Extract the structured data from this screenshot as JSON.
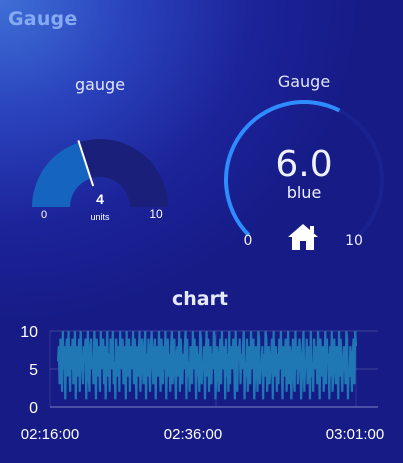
{
  "panel": {
    "title": "Gauge"
  },
  "gauge_left": {
    "label": "gauge",
    "value": 4,
    "value_text": "4",
    "units": "units",
    "min": 0,
    "max": 10,
    "min_text": "0",
    "max_text": "10",
    "colors": {
      "track": "#1a1f7a",
      "fill": "#1565c0",
      "needle": "#ffffff"
    }
  },
  "gauge_right": {
    "label": "Gauge",
    "value": 6.0,
    "value_text": "6.0",
    "subtitle": "blue",
    "min": 0,
    "max": 10,
    "min_text": "0",
    "max_text": "10",
    "icon": "home-icon",
    "colors": {
      "track": "#1a2290",
      "fill": "#2e8cff"
    }
  },
  "chart": {
    "title": "chart"
  },
  "chart_data": {
    "type": "line",
    "title": "chart",
    "xlabel": "",
    "ylabel": "",
    "ylim": [
      0,
      10
    ],
    "yticks": [
      "0",
      "5",
      "10"
    ],
    "xticks": [
      "02:16:00",
      "02:36:00",
      "03:01:00"
    ],
    "line_color": "#1f77b4",
    "grid": true,
    "series": [
      {
        "values": [
          6,
          8,
          3,
          9,
          7,
          2,
          10,
          5,
          8,
          1,
          7,
          9,
          4,
          10,
          6,
          2,
          8,
          5,
          9,
          3,
          7,
          10,
          1,
          6,
          8,
          4,
          9,
          2,
          10,
          7,
          5,
          3,
          8,
          6,
          9,
          1,
          7,
          10,
          4,
          2,
          8,
          9,
          5,
          6,
          3,
          10,
          7,
          1,
          9,
          4,
          8,
          6,
          2,
          10,
          5,
          7,
          9,
          3,
          8,
          1,
          6,
          10,
          4,
          7,
          2,
          9,
          5,
          8,
          10,
          3,
          6,
          1,
          9,
          7,
          4,
          8,
          2,
          10,
          6,
          5,
          9,
          3,
          7,
          8,
          1,
          10,
          4,
          6,
          9,
          2,
          8,
          5,
          7,
          10,
          3,
          9,
          6,
          1,
          8,
          4,
          7,
          10,
          2,
          5,
          9,
          6,
          3,
          8,
          10,
          1,
          7,
          4,
          9,
          5,
          2,
          8,
          10,
          6,
          3,
          7,
          9,
          1,
          8,
          5,
          4,
          10,
          6,
          2,
          9,
          7,
          3,
          8,
          5,
          10,
          1,
          6,
          9,
          4,
          7,
          2,
          8,
          10,
          3,
          6,
          9,
          5,
          1,
          7,
          8,
          4,
          10,
          2,
          9,
          6,
          3,
          7,
          5,
          8,
          10,
          1,
          9,
          4,
          6,
          2,
          8,
          7,
          3,
          10,
          5,
          9,
          6,
          1,
          8,
          4,
          7,
          2,
          10,
          9,
          3,
          6,
          5,
          8,
          1,
          7,
          10,
          4,
          9,
          2,
          6,
          8,
          3,
          7,
          5,
          10,
          9,
          1,
          4,
          8,
          6,
          2,
          7,
          9,
          3,
          10,
          5,
          6,
          8,
          1,
          9,
          4,
          7,
          2,
          10,
          3,
          8,
          6,
          5,
          9,
          7,
          1,
          10,
          4,
          2,
          8,
          6,
          9,
          3,
          7,
          5,
          8,
          10,
          1,
          6,
          4,
          9,
          2,
          7,
          8,
          3,
          10,
          5,
          6,
          9,
          1,
          4,
          8,
          7,
          2,
          10,
          9,
          3,
          6,
          5,
          8,
          1,
          7,
          4,
          10,
          9,
          2,
          6,
          8,
          3,
          5,
          7,
          9,
          1,
          10,
          4,
          6,
          8,
          2,
          7,
          3,
          9,
          5,
          10,
          6,
          1,
          8,
          4,
          7,
          9,
          2,
          5,
          10,
          3,
          8,
          6,
          1,
          7,
          9,
          4,
          2,
          10,
          5,
          8,
          3,
          6,
          9,
          7,
          1,
          4,
          8,
          10,
          2,
          6,
          5,
          9,
          3,
          7,
          8,
          1,
          10,
          4,
          6,
          2,
          9,
          7,
          5,
          8,
          3,
          10,
          6,
          1,
          9,
          4,
          7,
          8,
          2,
          5,
          10,
          3,
          9,
          6,
          7,
          1,
          8,
          4,
          10,
          2,
          5,
          9,
          6,
          3,
          8,
          7,
          1,
          10,
          4,
          9,
          5,
          2,
          6,
          8,
          7,
          3,
          10,
          9,
          1,
          5,
          4,
          8,
          6,
          2,
          7,
          9,
          3,
          10,
          8
        ]
      }
    ]
  }
}
